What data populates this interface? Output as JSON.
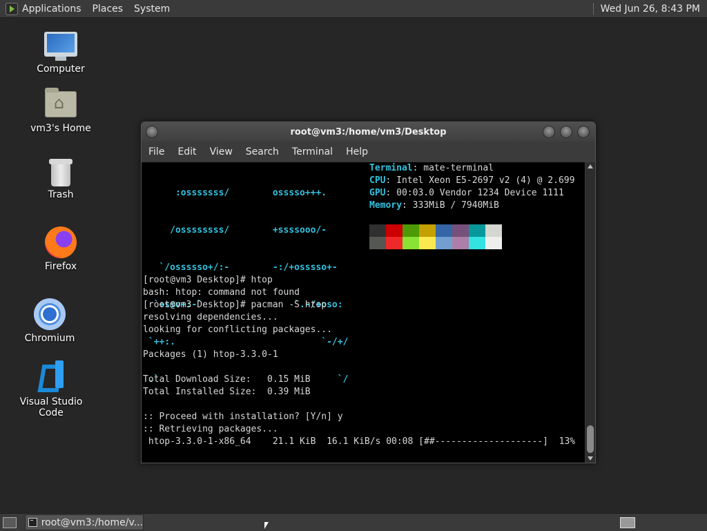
{
  "top_panel": {
    "menus": [
      "Applications",
      "Places",
      "System"
    ],
    "clock": "Wed Jun 26,  8:43 PM"
  },
  "desktop_icons": [
    {
      "label": "Computer",
      "icon": "computer-icon"
    },
    {
      "label": "vm3's Home",
      "icon": "home-folder-icon"
    },
    {
      "label": "Trash",
      "icon": "trash-icon"
    },
    {
      "label": "Firefox",
      "icon": "firefox-icon"
    },
    {
      "label": "Chromium",
      "icon": "chromium-icon"
    },
    {
      "label": "Visual Studio Code",
      "icon": "vscode-icon"
    }
  ],
  "window": {
    "title": "root@vm3:/home/vm3/Desktop",
    "menus": [
      "File",
      "Edit",
      "View",
      "Search",
      "Terminal",
      "Help"
    ]
  },
  "neofetch": {
    "ascii": [
      "      :osssssss/        osssso+++.",
      "     /ossssssss/        +ssssooo/-",
      "   `/ossssso+/:-        -:/+osssso+-",
      "  `+sso+:-`                 `.-/+oso:",
      " `++:.                           `-/+/",
      " .`                                 `/"
    ],
    "info": [
      {
        "key": "Terminal",
        "value": ": mate-terminal"
      },
      {
        "key": "CPU",
        "value": ": Intel Xeon E5-2697 v2 (4) @ 2.699"
      },
      {
        "key": "GPU",
        "value": ": 00:03.0 Vendor 1234 Device 1111"
      },
      {
        "key": "Memory",
        "value": ": 333MiB / 7940MiB"
      }
    ],
    "palette_top": [
      "#303030",
      "#cc0000",
      "#4e9a06",
      "#c4a000",
      "#3465a4",
      "#75507b",
      "#06989a",
      "#d3d7cf"
    ],
    "palette_bottom": [
      "#555753",
      "#ef2929",
      "#8ae234",
      "#fce94f",
      "#729fcf",
      "#ad7fa8",
      "#34e2e2",
      "#eeeeec"
    ]
  },
  "terminal_log": [
    "[root@vm3 Desktop]# htop",
    "bash: htop: command not found",
    "[root@vm3 Desktop]# pacman -S htop",
    "resolving dependencies...",
    "looking for conflicting packages...",
    "",
    "Packages (1) htop-3.3.0-1",
    "",
    "Total Download Size:   0.15 MiB",
    "Total Installed Size:  0.39 MiB",
    "",
    ":: Proceed with installation? [Y/n] y",
    ":: Retrieving packages...",
    " htop-3.3.0-1-x86_64    21.1 KiB  16.1 KiB/s 00:08 [##--------------------]  13%"
  ],
  "taskbar": {
    "task_label": "root@vm3:/home/v..."
  }
}
